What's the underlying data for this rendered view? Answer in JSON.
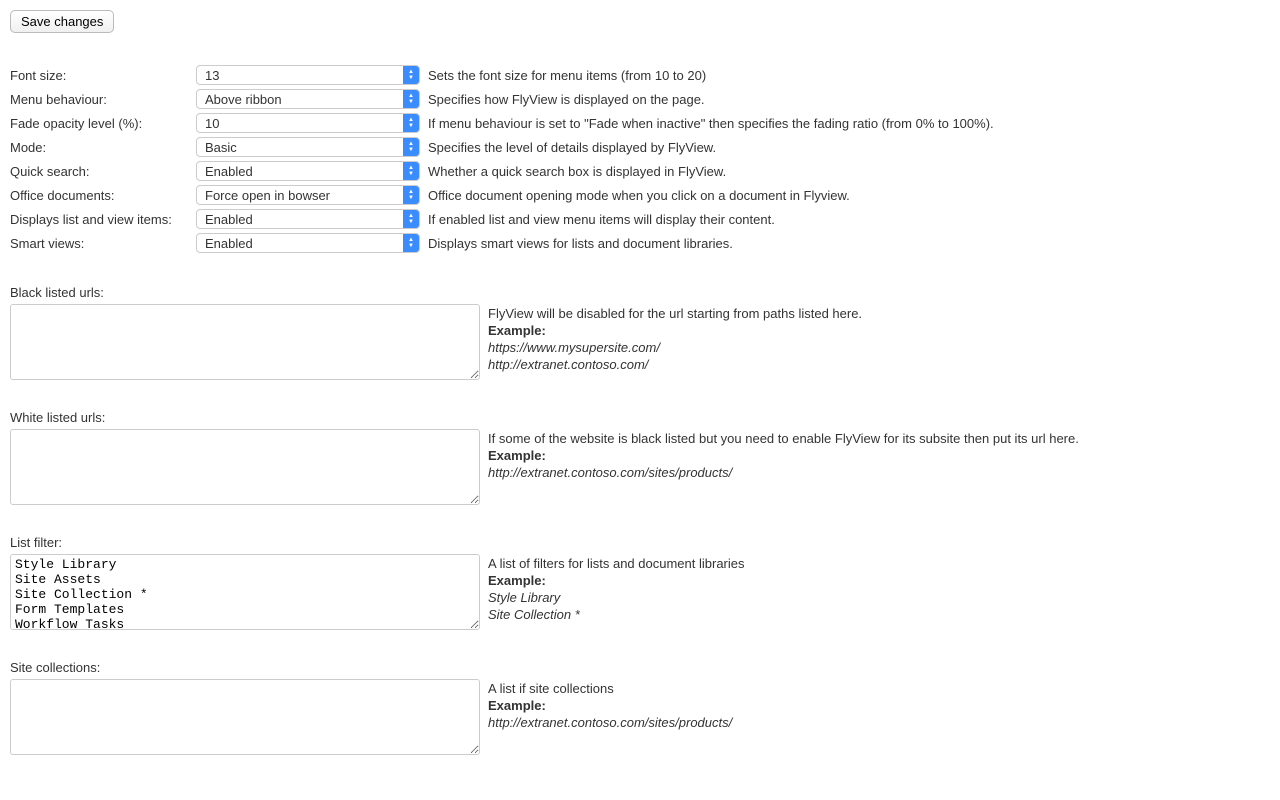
{
  "save_button": "Save changes",
  "settings": [
    {
      "label": "Font size:",
      "value": "13",
      "desc": "Sets the font size for menu items (from 10 to 20)"
    },
    {
      "label": "Menu behaviour:",
      "value": "Above ribbon",
      "desc": "Specifies how FlyView is displayed on the page."
    },
    {
      "label": "Fade opacity level (%):",
      "value": "10",
      "desc": "If menu behaviour is set to \"Fade when inactive\" then specifies the fading ratio (from 0% to 100%)."
    },
    {
      "label": "Mode:",
      "value": "Basic",
      "desc": "Specifies the level of details displayed by FlyView."
    },
    {
      "label": "Quick search:",
      "value": "Enabled",
      "desc": "Whether a quick search box is displayed in FlyView."
    },
    {
      "label": "Office documents:",
      "value": "Force open in bowser",
      "desc": "Office document opening mode when you click on a document in Flyview."
    },
    {
      "label": "Displays list and view items:",
      "value": "Enabled",
      "desc": "If enabled list and view menu items will display their content."
    },
    {
      "label": "Smart views:",
      "value": "Enabled",
      "desc": "Displays smart views for lists and document libraries."
    }
  ],
  "sections": {
    "black_listed": {
      "label": "Black listed urls:",
      "value": "",
      "desc": "FlyView will be disabled for the url starting from paths listed here.",
      "example_label": "Example:",
      "example1": "https://www.mysupersite.com/",
      "example2": "http://extranet.contoso.com/"
    },
    "white_listed": {
      "label": "White listed urls:",
      "value": "",
      "desc": "If some of the website is black listed but you need to enable FlyView for its subsite then put its url here.",
      "example_label": "Example:",
      "example1": "http://extranet.contoso.com/sites/products/"
    },
    "list_filter": {
      "label": "List filter:",
      "value": "Style Library\nSite Assets\nSite Collection *\nForm Templates\nWorkflow Tasks",
      "desc": "A list of filters for lists and document libraries",
      "example_label": "Example:",
      "example1": "Style Library",
      "example2": "Site Collection *"
    },
    "site_collections": {
      "label": "Site collections:",
      "value": "",
      "desc": "A list if site collections",
      "example_label": "Example:",
      "example1": "http://extranet.contoso.com/sites/products/"
    }
  }
}
